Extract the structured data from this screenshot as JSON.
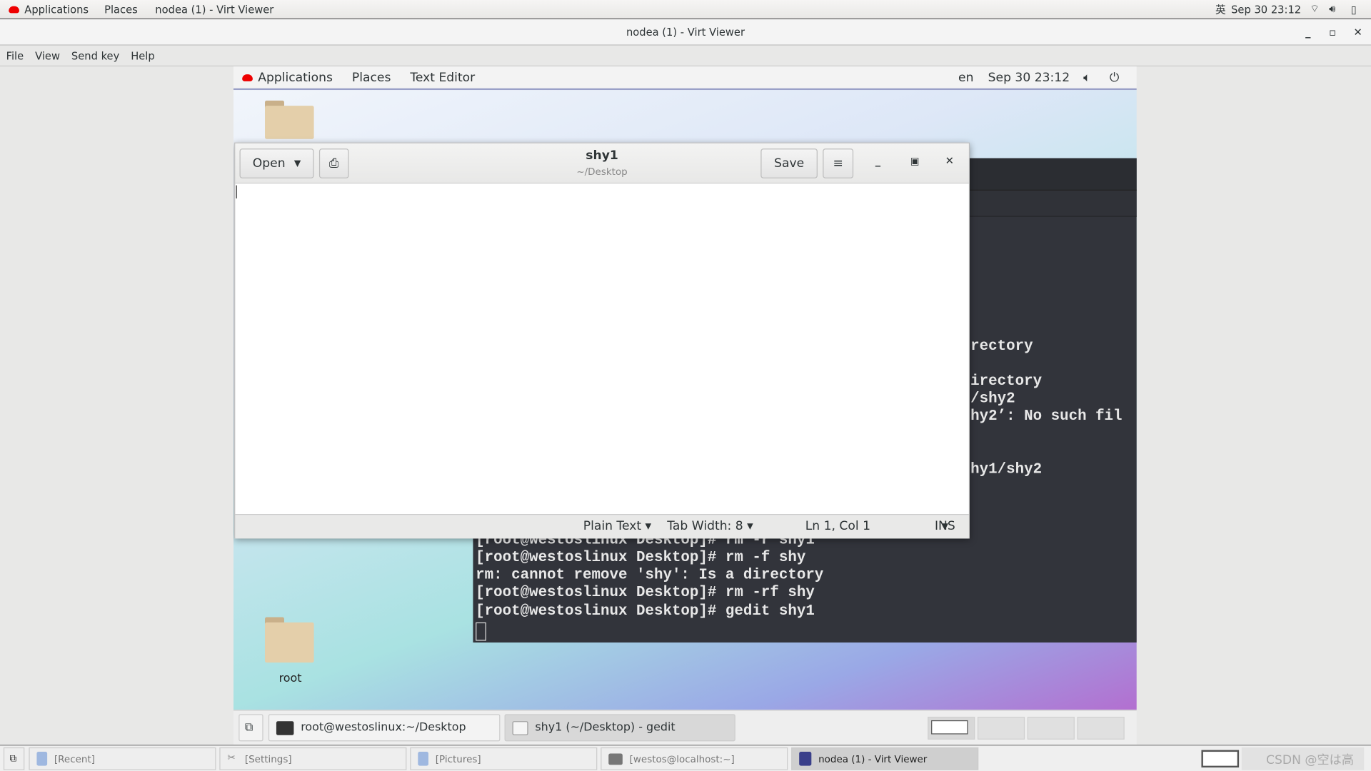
{
  "host_topbar": {
    "applications": "Applications",
    "places": "Places",
    "window": "nodea (1) - Virt Viewer",
    "ime": "英",
    "datetime": "Sep 30  23:12"
  },
  "window": {
    "title": "nodea (1) - Virt Viewer",
    "minimize": "_",
    "maximize": "▫",
    "close": "✕"
  },
  "menu": [
    "File",
    "View",
    "Send key",
    "Help"
  ],
  "vm_topbar": {
    "applications": "Applications",
    "places": "Places",
    "app": "Text Editor",
    "lang": "en",
    "datetime": "Sep 30  23:12"
  },
  "desktop": {
    "icons": [
      {
        "label": "root"
      }
    ]
  },
  "terminal": {
    "right_fragments": [
      "rectory",
      "irectory",
      "/shy2",
      "hy2’: No such fil",
      "hy1/shy2"
    ],
    "bottom_lines": [
      "[root@westoslinux Desktop]# rm -r shy1",
      "[root@westoslinux Desktop]# rm -f shy",
      "rm: cannot remove 'shy': Is a directory",
      "[root@westoslinux Desktop]# rm -rf shy",
      "[root@westoslinux Desktop]# gedit shy1"
    ]
  },
  "gedit": {
    "open": "Open",
    "title": "shy1",
    "subtitle": "~/Desktop",
    "save": "Save",
    "menu_icon": "≡",
    "content": "",
    "status": {
      "language": "Plain Text",
      "tab_width": "Tab Width: 8",
      "position": "Ln 1, Col 1",
      "mode": "INS"
    }
  },
  "vm_taskbar": {
    "tasks": [
      {
        "label": "root@westoslinux:~/Desktop",
        "active": false
      },
      {
        "label": "shy1 (~/Desktop) - gedit",
        "active": true
      }
    ]
  },
  "host_taskbar": {
    "tasks": [
      {
        "label": "[Recent]"
      },
      {
        "label": "[Settings]"
      },
      {
        "label": "[Pictures]"
      },
      {
        "label": "[westos@localhost:~]"
      },
      {
        "label": "nodea (1) - Virt Viewer",
        "active": true
      }
    ],
    "watermark": "CSDN @空は高"
  }
}
